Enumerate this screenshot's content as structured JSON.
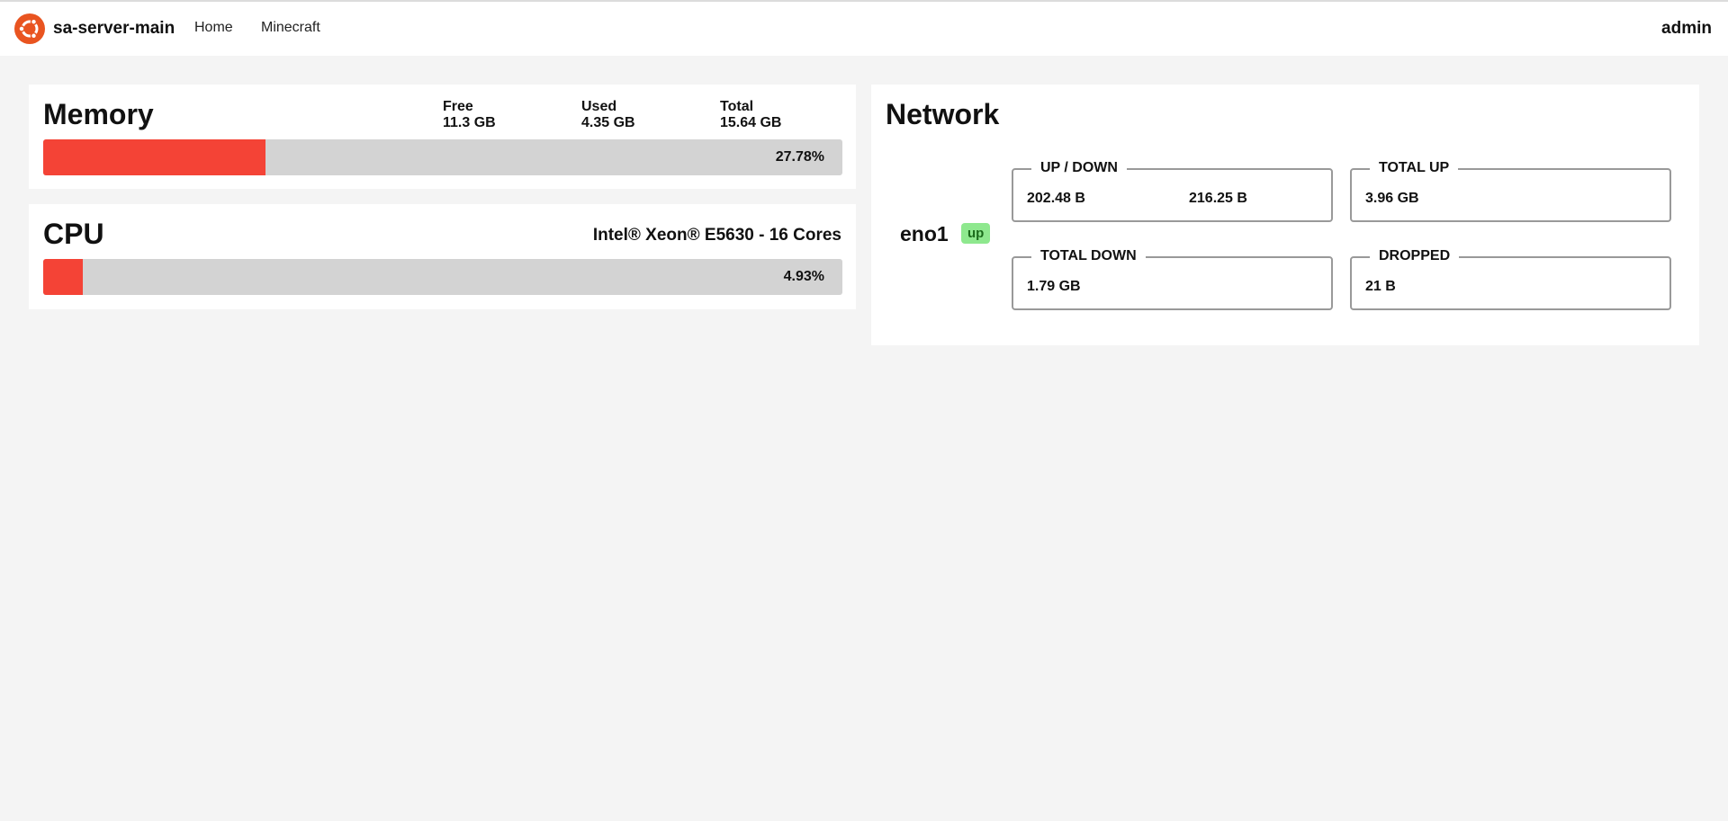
{
  "navbar": {
    "brand": "sa-server-main",
    "links": [
      "Home",
      "Minecraft"
    ],
    "user": "admin",
    "logo_icon": "ubuntu-logo-icon"
  },
  "memory": {
    "title": "Memory",
    "free_label": "Free",
    "free_value": "11.3 GB",
    "used_label": "Used",
    "used_value": "4.35 GB",
    "total_label": "Total",
    "total_value": "15.64 GB",
    "usage_percent": 27.78,
    "usage_label": "27.78%"
  },
  "cpu": {
    "title": "CPU",
    "model": "Intel® Xeon® E5630 - 16 Cores",
    "usage_percent": 4.93,
    "usage_label": "4.93%"
  },
  "network": {
    "title": "Network",
    "interface": "eno1",
    "status": "up",
    "up_down_label": "UP / DOWN",
    "up_value": "202.48 B",
    "down_value": "216.25 B",
    "total_up_label": "TOTAL UP",
    "total_up_value": "3.96 GB",
    "total_down_label": "TOTAL DOWN",
    "total_down_value": "1.79 GB",
    "dropped_label": "DROPPED",
    "dropped_value": "21 B"
  },
  "colors": {
    "accent_red": "#f44336",
    "bar_track": "#d3d3d3",
    "status_green": "#8ee88e",
    "logo_orange": "#e95420"
  }
}
